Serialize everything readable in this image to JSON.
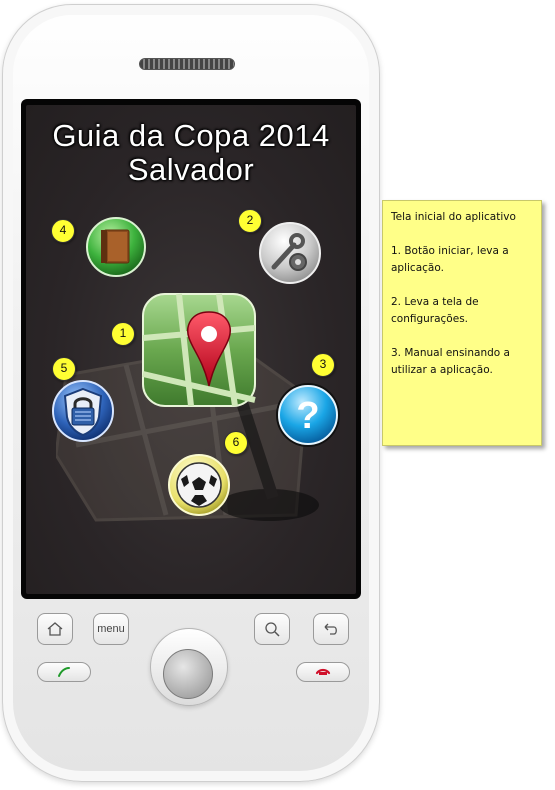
{
  "app": {
    "title_line1": "Guia da Copa 2014",
    "title_line2": "Salvador"
  },
  "markers": [
    "1",
    "2",
    "3",
    "4",
    "5",
    "6"
  ],
  "icons": {
    "start": "map-pin-icon",
    "settings": "tools-gear-icon",
    "help": "question-mark-icon",
    "manual": "book-icon",
    "security": "padlock-shield-icon",
    "football": "soccer-ball-icon"
  },
  "hardware": {
    "menu_label": "menu"
  },
  "note": {
    "heading": "Tela inicial do aplicativo",
    "item1": "1. Botão iniciar, leva a aplicação.",
    "item2": "2. Leva a tela de configurações.",
    "item3": "3. Manual ensinando a utilizar a aplicação."
  },
  "colors": {
    "screen_bg": "#2a2527",
    "marker": "#ffff33",
    "note_bg": "#ffff88",
    "help_blue": "#1aa6e6",
    "map_green": "#6aa84f",
    "pin_red": "#d0102a"
  }
}
